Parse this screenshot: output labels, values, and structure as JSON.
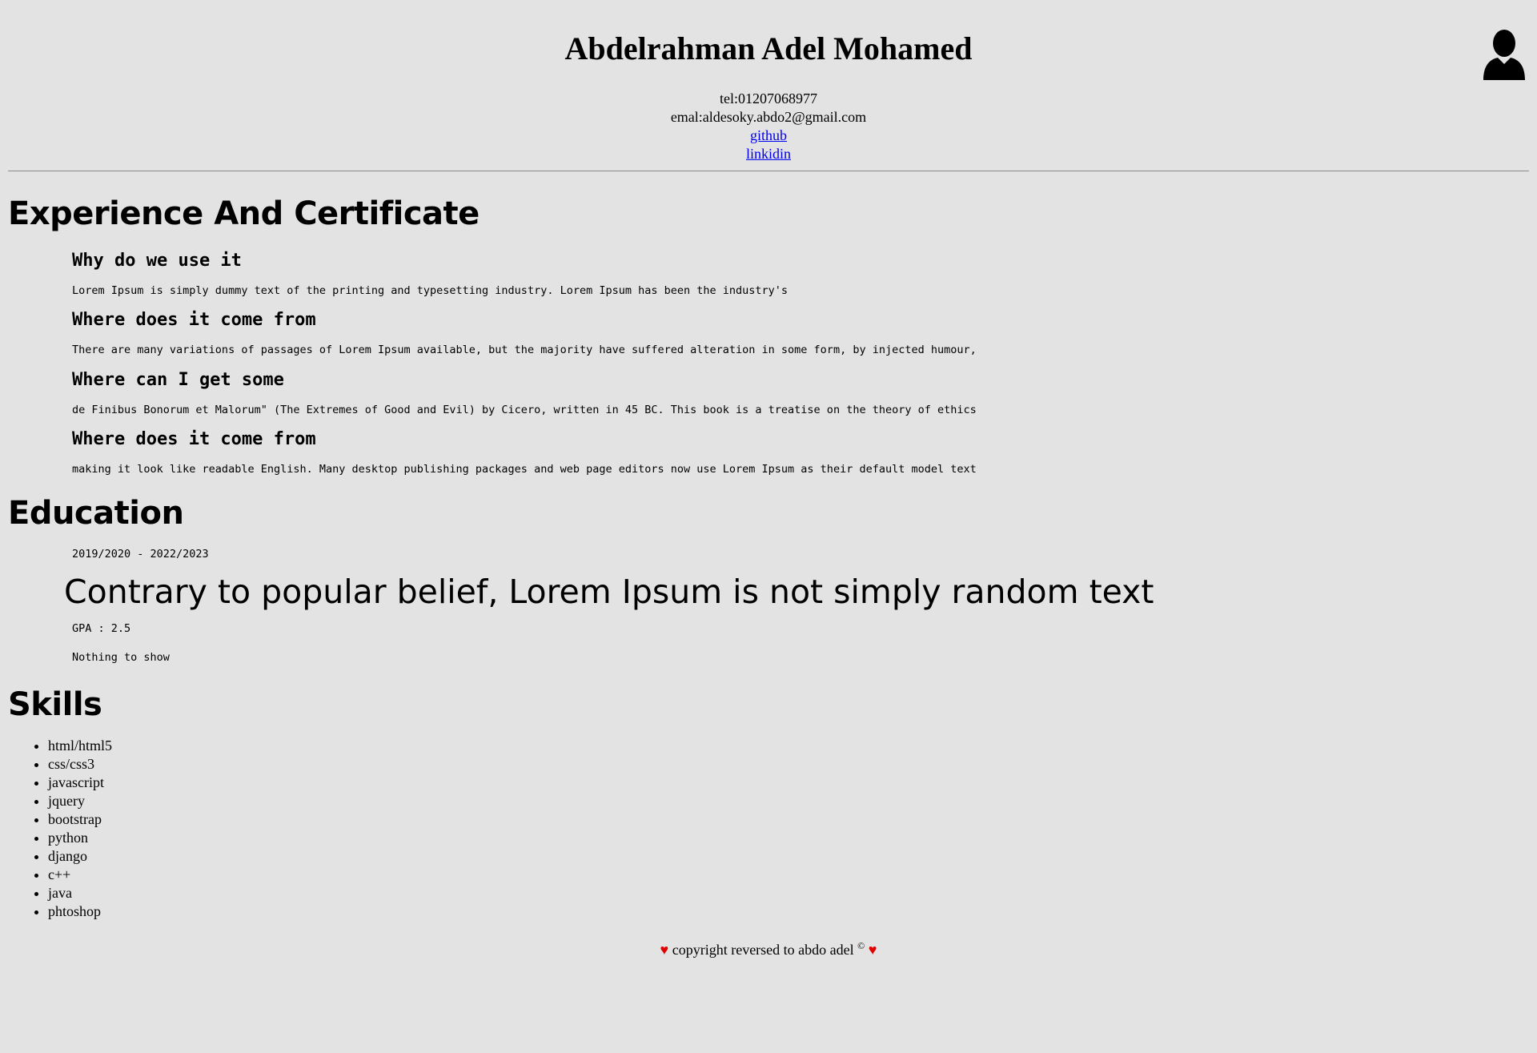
{
  "header": {
    "name": "Abdelrahman Adel Mohamed",
    "tel": "tel:01207068977",
    "email": "emal:aldesoky.abdo2@gmail.com",
    "github_label": "github",
    "linkedin_label": "linkidin",
    "avatar_icon": "user-silhouette-icon"
  },
  "experience": {
    "title": "Experience And Certificate",
    "items": [
      {
        "heading": "Why do we use it",
        "text": "Lorem Ipsum is simply dummy text of the printing and typesetting industry. Lorem Ipsum has been the industry's"
      },
      {
        "heading": "Where does it come from",
        "text": "There are many variations of passages of Lorem Ipsum available, but the majority have suffered alteration in some form, by injected humour,"
      },
      {
        "heading": "Where can I get some",
        "text": "de Finibus Bonorum et Malorum\" (The Extremes of Good and Evil) by Cicero, written in 45 BC. This book is a treatise on the theory of ethics"
      },
      {
        "heading": "Where does it come from",
        "text": "making it look like readable English. Many desktop publishing packages and web page editors now use Lorem Ipsum as their default model text"
      }
    ]
  },
  "education": {
    "title": "Education",
    "years": "2019/2020 - 2022/2023",
    "headline": "Contrary to popular belief, Lorem Ipsum is not simply random text",
    "gpa": "GPA : 2.5",
    "note": "Nothing to show"
  },
  "skills": {
    "title": "Skills",
    "items": [
      "html/html5",
      "css/css3",
      "javascript",
      "jquery",
      "bootstrap",
      "python",
      "django",
      "c++",
      "java",
      "phtoshop"
    ]
  },
  "footer": {
    "text": "copyright reversed to abdo adel",
    "copyright_symbol": "©",
    "heart_symbol": "♥",
    "heart_color": "#e00000"
  },
  "colors": {
    "background": "#e3e3e3",
    "link": "#0000ee"
  }
}
